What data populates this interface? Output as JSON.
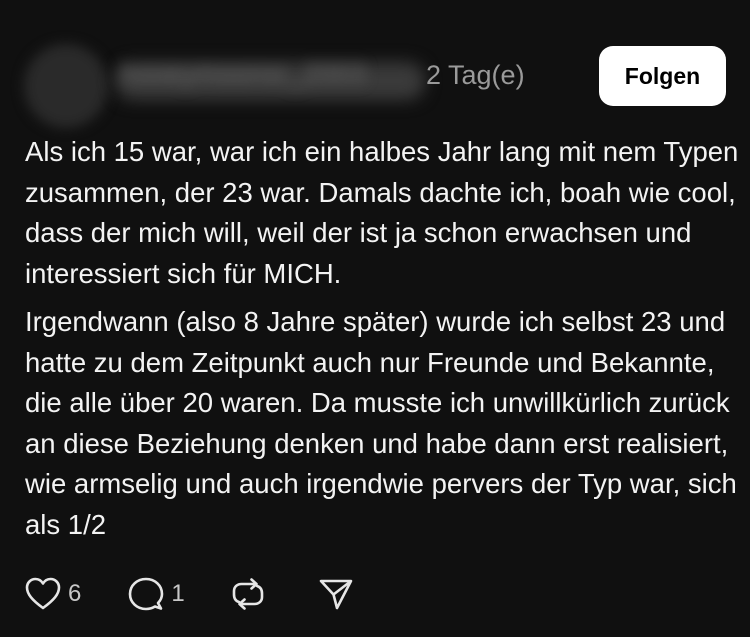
{
  "post": {
    "author_blurred": "hooeymoonsr_2003",
    "time": "2 Tag(e)",
    "follow_label": "Folgen",
    "paragraphs": [
      "Als ich 15 war, war ich ein halbes Jahr lang mit nem Typen zusammen, der 23 war. Damals dachte ich, boah wie cool, dass der mich will, weil der ist ja schon erwachsen und interessiert sich für MICH.",
      "Irgendwann (also 8 Jahre später) wurde ich selbst 23 und hatte zu dem Zeitpunkt auch nur Freunde und Bekannte, die alle über 20 waren. Da musste ich unwillkürlich zurück an diese Beziehung denken und habe dann erst realisiert, wie armselig und auch irgendwie pervers der Typ war, sich als 1/2"
    ],
    "likes": "6",
    "replies": "1",
    "icons": [
      "heart-icon",
      "comment-icon",
      "repost-icon",
      "share-icon"
    ]
  }
}
